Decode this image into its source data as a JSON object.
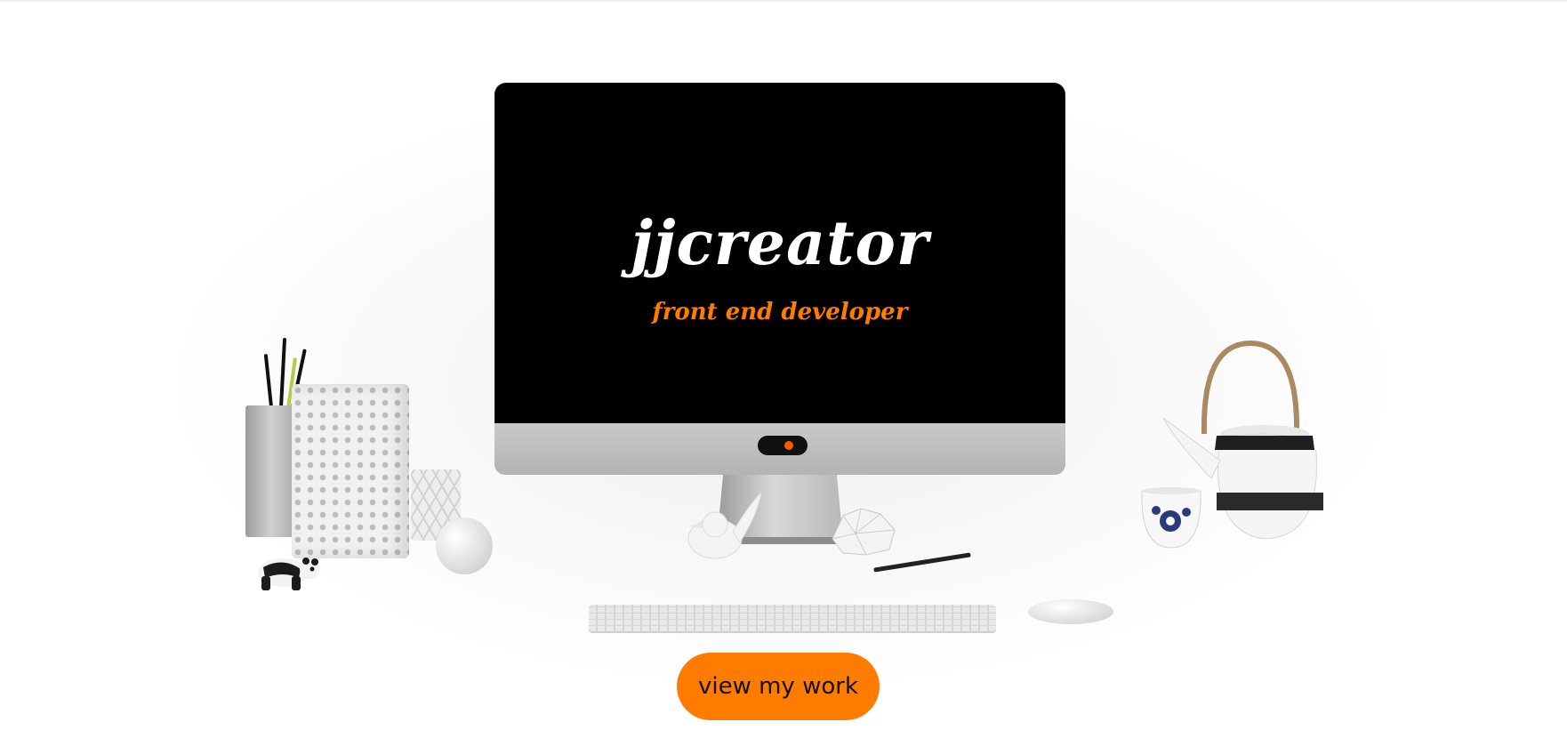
{
  "hero": {
    "brand_title": "jjcreator",
    "brand_subtitle": "front end developer",
    "cta_label": "view my work"
  },
  "colors": {
    "accent": "#ff7c00",
    "screen": "#000000",
    "background": "#ffffff"
  },
  "icons": {
    "camera_indicator": "camera-dot-icon"
  }
}
